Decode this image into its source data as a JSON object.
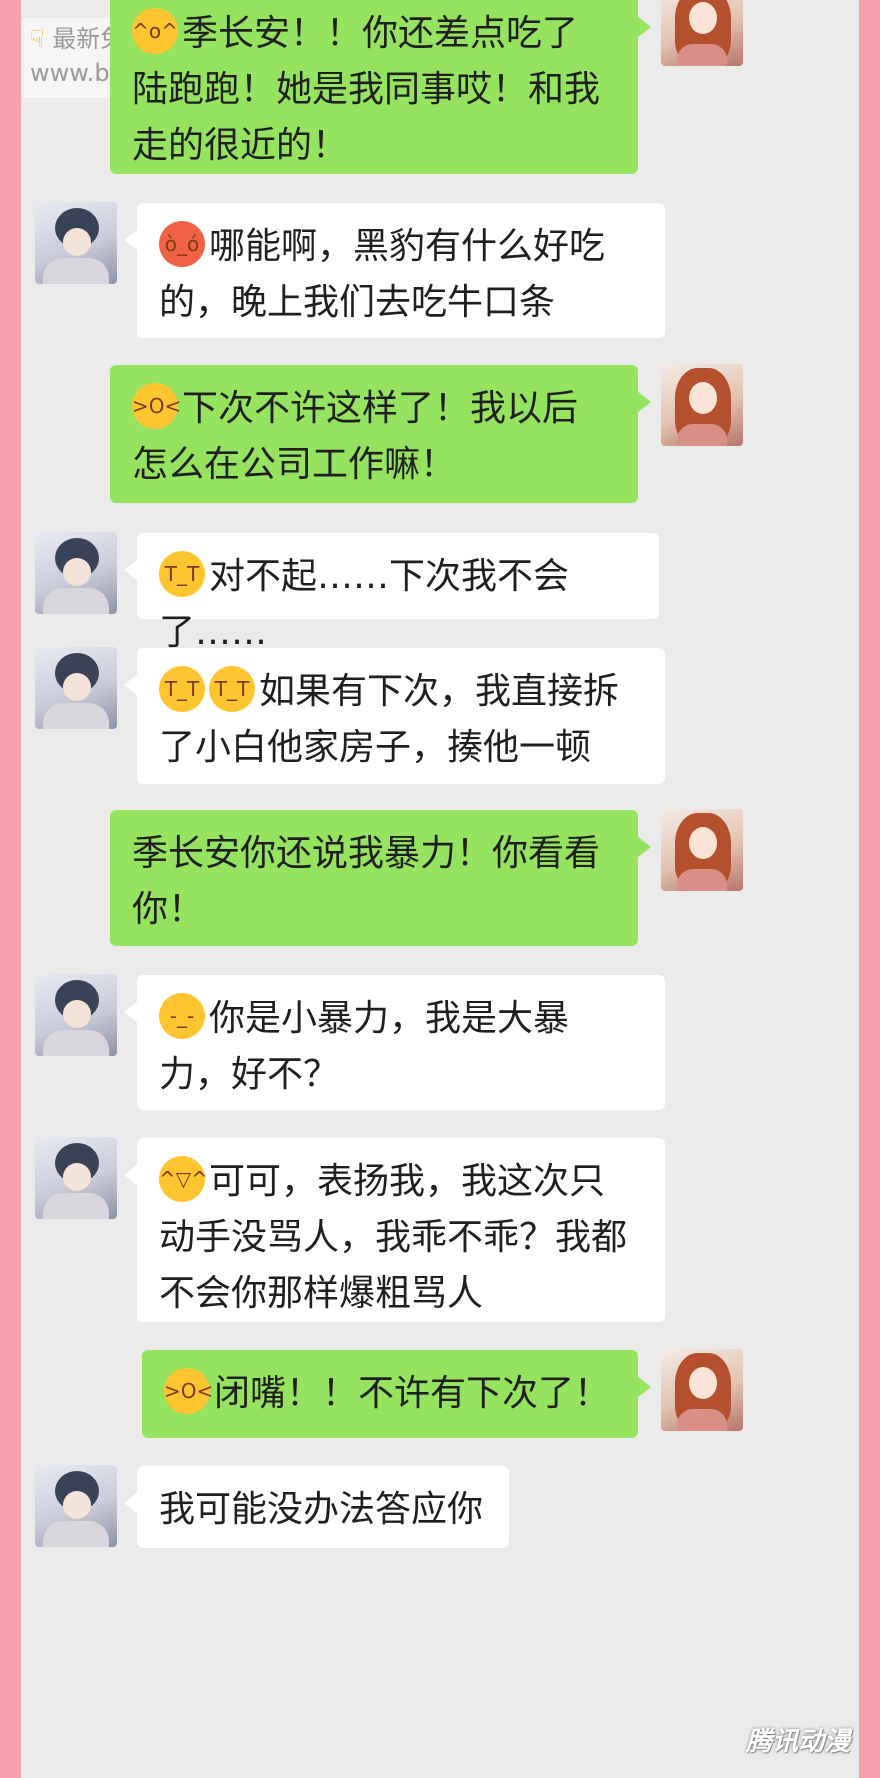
{
  "messages": [
    {
      "side": "right",
      "text": "季长安！！你还差点吃了\n陆跑跑！她是我同事哎！和我\n走的很近的！",
      "emoji": [
        "laugh-emoji"
      ]
    },
    {
      "side": "left",
      "text": "哪能啊，黑豹有什么好吃\n的，晚上我们去吃牛口条",
      "emoji": [
        "angry-emoji"
      ]
    },
    {
      "side": "right",
      "text": "下次不许这样了！我以后\n怎么在公司工作嘛！",
      "emoji": [
        "steam-face-emoji"
      ]
    },
    {
      "side": "left",
      "text": "对不起……下次我不会了……",
      "emoji": [
        "crying-emoji"
      ]
    },
    {
      "side": "left",
      "text": "如果有下次，我直接拆\n了小白他家房子，揍他一顿",
      "emoji": [
        "crying-emoji",
        "crying-emoji"
      ]
    },
    {
      "side": "right",
      "text": "季长安你还说我暴力！你看看\n你！",
      "emoji": []
    },
    {
      "side": "left",
      "text": "你是小暴力，我是大暴\n力，好不？",
      "emoji": [
        "pout-emoji"
      ]
    },
    {
      "side": "left",
      "text": "可可，表扬我，我这次只\n动手没骂人，我乖不乖？我都\n不会你那样爆粗骂人",
      "emoji": [
        "grin-emoji"
      ]
    },
    {
      "side": "right",
      "text": "闭嘴！！不许有下次了！",
      "emoji": [
        "steam-face-emoji"
      ]
    },
    {
      "side": "left",
      "text": "我可能没办法答应你",
      "emoji": []
    }
  ],
  "watermark": {
    "line1": "最新免费漫画",
    "line2": "www.baozimh.com"
  },
  "logo": "腾讯动漫"
}
